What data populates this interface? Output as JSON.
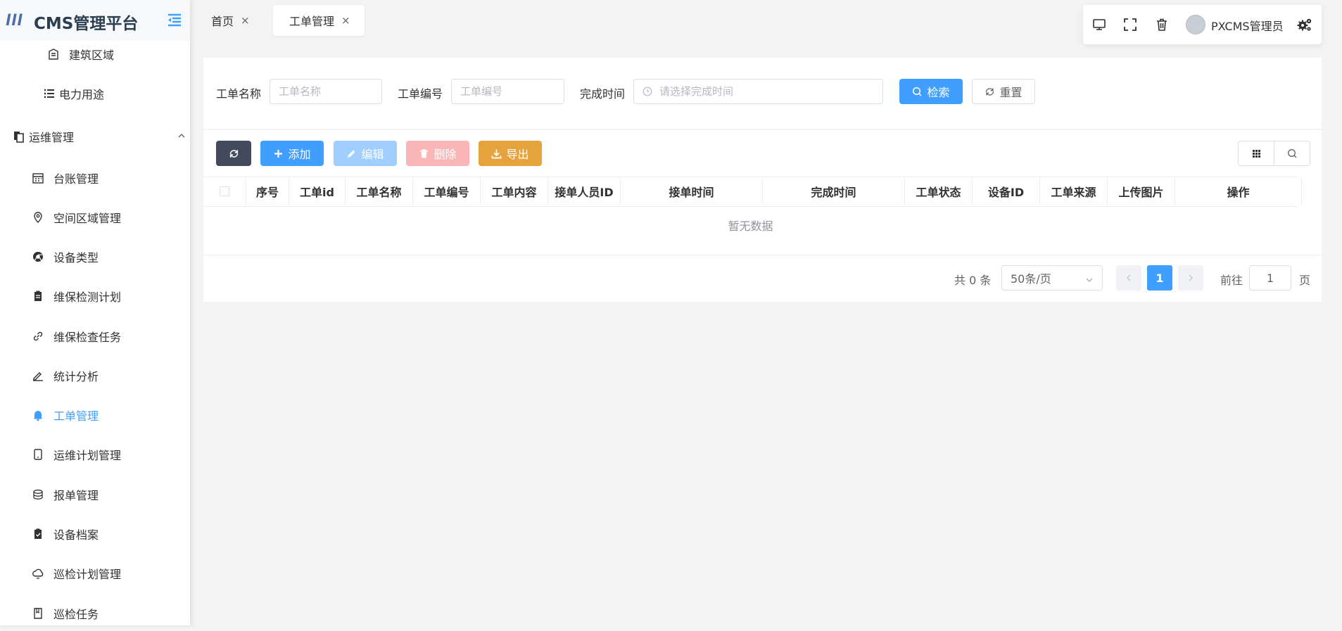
{
  "app": {
    "logo_mark": "lll",
    "title": "CMS管理平台"
  },
  "sidebar": {
    "items": [
      {
        "label": "建筑区域",
        "icon": "building-icon"
      },
      {
        "label": "电力用途",
        "icon": "list-icon"
      },
      {
        "label": "运维管理",
        "icon": "documents-icon",
        "group": true
      },
      {
        "label": "台账管理",
        "icon": "calendar-icon"
      },
      {
        "label": "空间区域管理",
        "icon": "location-icon"
      },
      {
        "label": "设备类型",
        "icon": "chrome-icon"
      },
      {
        "label": "维保检测计划",
        "icon": "clipboard-icon"
      },
      {
        "label": "维保检查任务",
        "icon": "link-icon"
      },
      {
        "label": "统计分析",
        "icon": "edit-icon"
      },
      {
        "label": "工单管理",
        "icon": "bell-icon",
        "active": true
      },
      {
        "label": "运维计划管理",
        "icon": "tablet-icon"
      },
      {
        "label": "报单管理",
        "icon": "coins-icon"
      },
      {
        "label": "设备档案",
        "icon": "clipboard-check-icon"
      },
      {
        "label": "巡检计划管理",
        "icon": "cloud-icon"
      },
      {
        "label": "巡检任务",
        "icon": "book-icon"
      }
    ]
  },
  "tabs": [
    {
      "label": "首页",
      "close": "×"
    },
    {
      "label": "工单管理",
      "close": "×",
      "active": true
    }
  ],
  "header": {
    "username": "PXCMS管理员"
  },
  "search": {
    "name_label": "工单名称",
    "name_placeholder": "工单名称",
    "number_label": "工单编号",
    "number_placeholder": "工单编号",
    "time_label": "完成时间",
    "time_placeholder": "请选择完成时间",
    "search_button": "检索",
    "reset_button": "重置"
  },
  "toolbar": {
    "add": "添加",
    "edit": "编辑",
    "delete": "删除",
    "export": "导出"
  },
  "table": {
    "columns": [
      "序号",
      "工单id",
      "工单名称",
      "工单编号",
      "工单内容",
      "接单人员ID",
      "接单时间",
      "完成时间",
      "工单状态",
      "设备ID",
      "工单来源",
      "上传图片",
      "操作"
    ],
    "empty_text": "暂无数据"
  },
  "pagination": {
    "total": "共 0 条",
    "page_size": "50条/页",
    "current_page": "1",
    "goto_label": "前往",
    "goto_value": "1",
    "page_suffix": "页"
  },
  "colors": {
    "primary": "#409eff",
    "dark_button": "#434a5e",
    "edit_disabled": "#a0cfff",
    "delete_disabled": "#fab6b6",
    "export": "#e6a23c"
  }
}
